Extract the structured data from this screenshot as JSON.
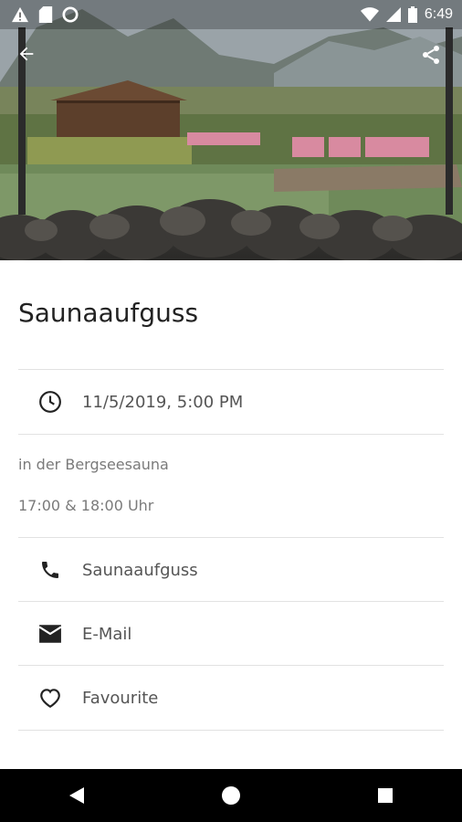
{
  "status_bar": {
    "time": "6:49",
    "icons": [
      "warning-icon",
      "sd-card-icon",
      "circle-icon",
      "wifi-icon",
      "signal-icon",
      "battery-icon"
    ]
  },
  "hero": {
    "alt": "Bergsee sauna garden with pond and pink loungers",
    "icons": [
      "back-arrow-icon",
      "share-icon"
    ]
  },
  "event": {
    "title": "Saunaaufguss",
    "datetime": "11/5/2019, 5:00 PM",
    "location": "in der Bergseesauna",
    "times": "17:00 & 18:00 Uhr"
  },
  "actions": {
    "phone_label": "Saunaaufguss",
    "email_label": "E-Mail",
    "favourite_label": "Favourite"
  },
  "nav_bar": {
    "icons": [
      "back-triangle-icon",
      "home-circle-icon",
      "recents-square-icon"
    ]
  }
}
